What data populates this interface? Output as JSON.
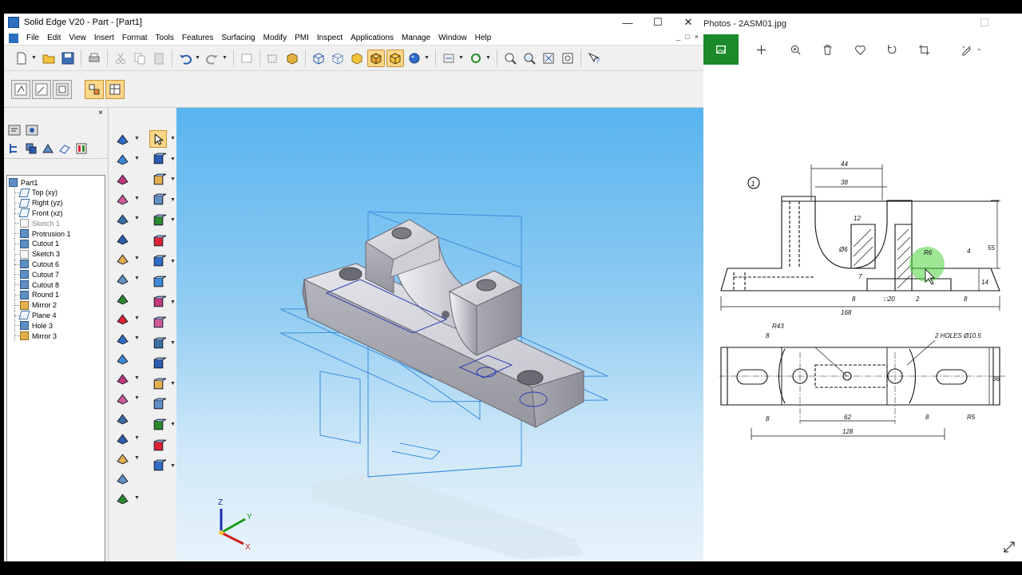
{
  "solid_edge": {
    "title": "Solid Edge V20 - Part - [Part1]",
    "menu": [
      "File",
      "Edit",
      "View",
      "Insert",
      "Format",
      "Tools",
      "Features",
      "Surfacing",
      "Modify",
      "PMI",
      "Inspect",
      "Applications",
      "Manage",
      "Window",
      "Help"
    ],
    "window_controls": [
      "—",
      "☐",
      "✕"
    ],
    "mdi_controls": [
      "_",
      "□",
      "×"
    ],
    "pathfinder": {
      "close_label": "×",
      "root": "Part1",
      "items": [
        {
          "label": "Top (xy)",
          "kind": "plane",
          "active": true
        },
        {
          "label": "Right (yz)",
          "kind": "plane",
          "active": true
        },
        {
          "label": "Front (xz)",
          "kind": "plane",
          "active": true
        },
        {
          "label": "Sketch 1",
          "kind": "sketch",
          "active": false
        },
        {
          "label": "Protrusion 1",
          "kind": "feature",
          "active": true
        },
        {
          "label": "Cutout 1",
          "kind": "feature",
          "active": true
        },
        {
          "label": "Sketch 3",
          "kind": "sketch",
          "active": true
        },
        {
          "label": "Cutout 6",
          "kind": "feature",
          "active": true
        },
        {
          "label": "Cutout 7",
          "kind": "feature",
          "active": true
        },
        {
          "label": "Cutout 8",
          "kind": "feature",
          "active": true
        },
        {
          "label": "Round 1",
          "kind": "feature",
          "active": true
        },
        {
          "label": "Mirror 2",
          "kind": "mirror",
          "active": true
        },
        {
          "label": "Plane 4",
          "kind": "plane",
          "active": true
        },
        {
          "label": "Hole 3",
          "kind": "feature",
          "active": true
        },
        {
          "label": "Mirror 3",
          "kind": "mirror",
          "active": true
        }
      ]
    },
    "axis_labels": {
      "z": "Z",
      "y": "Y",
      "x": "X"
    }
  },
  "photos": {
    "title": "Photos - 2ASM01.jpg",
    "tools": [
      "home-icon",
      "add-icon",
      "zoom-icon",
      "delete-icon",
      "favorite-icon",
      "rotate-icon",
      "crop-icon",
      "edit-icon"
    ],
    "drawing": {
      "view_number": "1",
      "dims": {
        "d44": "44",
        "d38": "38",
        "d12": "12",
        "d6": "Ø6",
        "dr6": "R6",
        "d4": "4",
        "d55": "55",
        "d14": "14",
        "d7": "7",
        "d8a": "8",
        "d20": "□20",
        "d2": "2",
        "d8b": "8",
        "d168": "168",
        "dr43": "R43",
        "dholes": "2 HOLES Ø10.5",
        "d8c": "8",
        "d36": "36",
        "d8d": "8",
        "d62": "62",
        "d8e": "8",
        "dr5": "R5",
        "d128": "128"
      }
    }
  },
  "colors": {
    "accent_orange": "#fbd78a",
    "photos_green": "#1a8a2a",
    "viewport_sky": "#58b4ef",
    "plane_lines": "#3b8fe0"
  }
}
